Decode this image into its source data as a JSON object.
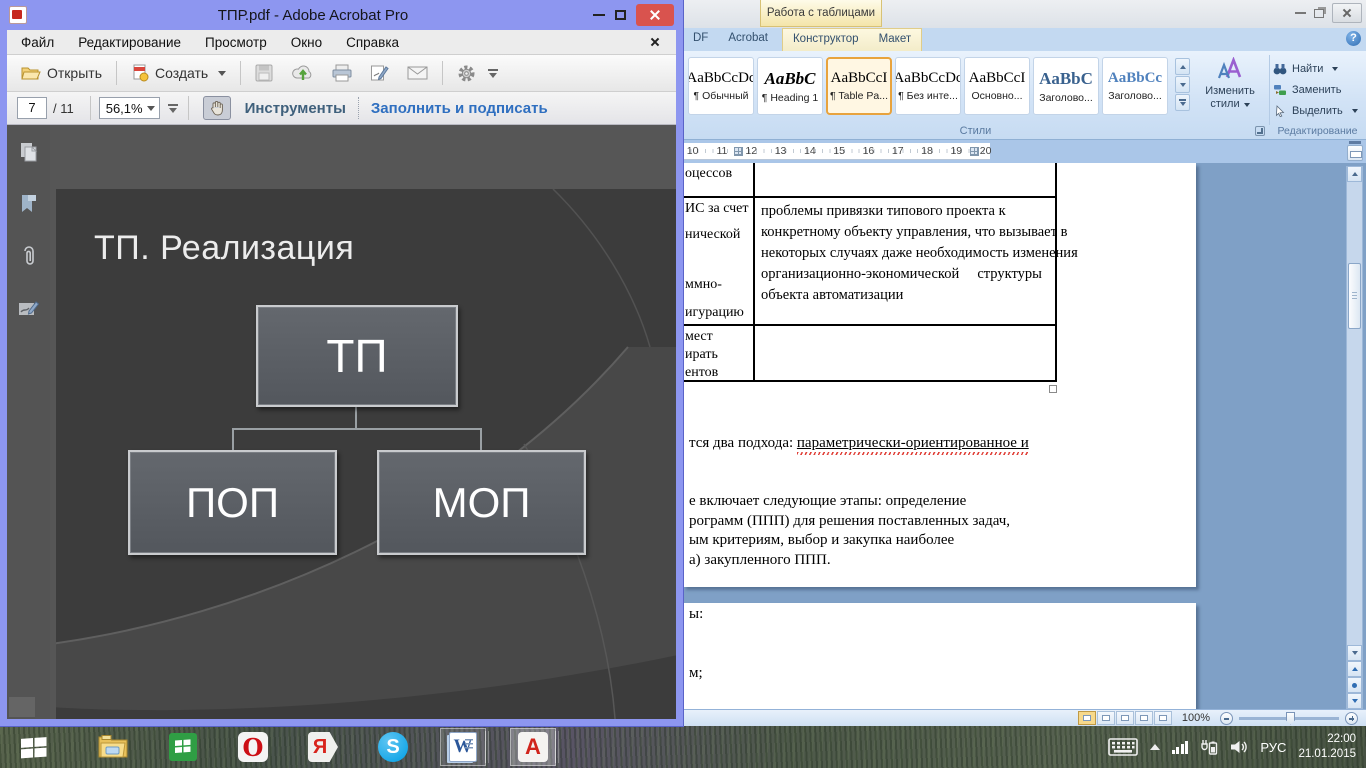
{
  "colors": {
    "acrobat_frame": "#8d96f0",
    "slide_bg": "#3c3c3c",
    "node_fill": "#5b5f65",
    "word_theme_blue": "#bfd4ec",
    "style_selected_border": "#e8a33d",
    "tools_label": "#3f607c",
    "fill_sign_link": "#2f6fc0"
  },
  "acrobat": {
    "title": "ТПР.pdf - Adobe Acrobat Pro",
    "menus": [
      "Файл",
      "Редактирование",
      "Просмотр",
      "Окно",
      "Справка"
    ],
    "toolbar": {
      "open": "Открыть",
      "create": "Создать",
      "page_current": "7",
      "page_total": "/ 11",
      "zoom": "56,1%",
      "tools": "Инструменты",
      "fill_sign": "Заполнить и подписать"
    },
    "slide": {
      "title": "ТП. Реализация",
      "root": "ТП",
      "child_left": "ПОП",
      "child_right": "МОП"
    }
  },
  "word": {
    "context_group": "Работа с таблицами",
    "tabs": [
      {
        "label": "DF"
      },
      {
        "label": "Acrobat"
      },
      {
        "label": "Конструктор"
      },
      {
        "label": "Макет"
      }
    ],
    "help_glyph": "?",
    "styles": {
      "group_label": "Стили",
      "change_styles_line1": "Изменить",
      "change_styles_line2": "стили",
      "chips": [
        {
          "sample": "AaBbCcDc",
          "label": "¶ Обычный"
        },
        {
          "sample": "AaBbC",
          "label": "¶ Heading 1"
        },
        {
          "sample": "AaBbCcI",
          "label": "¶ Table Pa..."
        },
        {
          "sample": "AaBbCcDc",
          "label": "¶ Без инте..."
        },
        {
          "sample": "AaBbCcI",
          "label": "Основно..."
        },
        {
          "sample": "AaBbC",
          "label": "Заголово..."
        },
        {
          "sample": "AaBbCc",
          "label": "Заголово..."
        }
      ]
    },
    "editing": {
      "group_label": "Редактирование",
      "find": "Найти",
      "replace": "Заменить",
      "select": "Выделить"
    },
    "ruler": {
      "numbers": [
        "10",
        "11",
        "12",
        "13",
        "14",
        "15",
        "16",
        "17",
        "18",
        "19",
        "20"
      ]
    },
    "doc": {
      "table": {
        "row1_left": "оцессов",
        "row2_left": [
          "ИС за счет",
          "нической",
          "ммно-",
          "игурацию"
        ],
        "row2_right": [
          "проблемы привязки типового проекта к",
          "конкретному объекту управления, что вызывает в",
          "некоторых случаях даже необходимость изменения",
          "организационно-экономической     структуры",
          "объекта автоматизации"
        ],
        "row3_left": [
          "мест",
          "ирать",
          "ентов"
        ]
      },
      "para_prefix": "тся два подхода: ",
      "para_link": "параметрически-ориентированное и",
      "block": [
        "е включает следующие этапы: определение",
        "рограмм (ППП) для решения поставленных задач,",
        "ым критериям, выбор и закупка наиболее",
        "а) закупленного ППП."
      ],
      "page2_line1": "ы:",
      "page2_line2": "м;"
    },
    "status": {
      "zoom": "100%"
    }
  },
  "taskbar": {
    "glyphs": {
      "opera": "O",
      "yandex": "Я",
      "skype": "S",
      "word": "W",
      "acrobat": "A"
    },
    "tray": {
      "lang": "РУС",
      "time": "22:00",
      "date": "21.01.2015"
    }
  }
}
